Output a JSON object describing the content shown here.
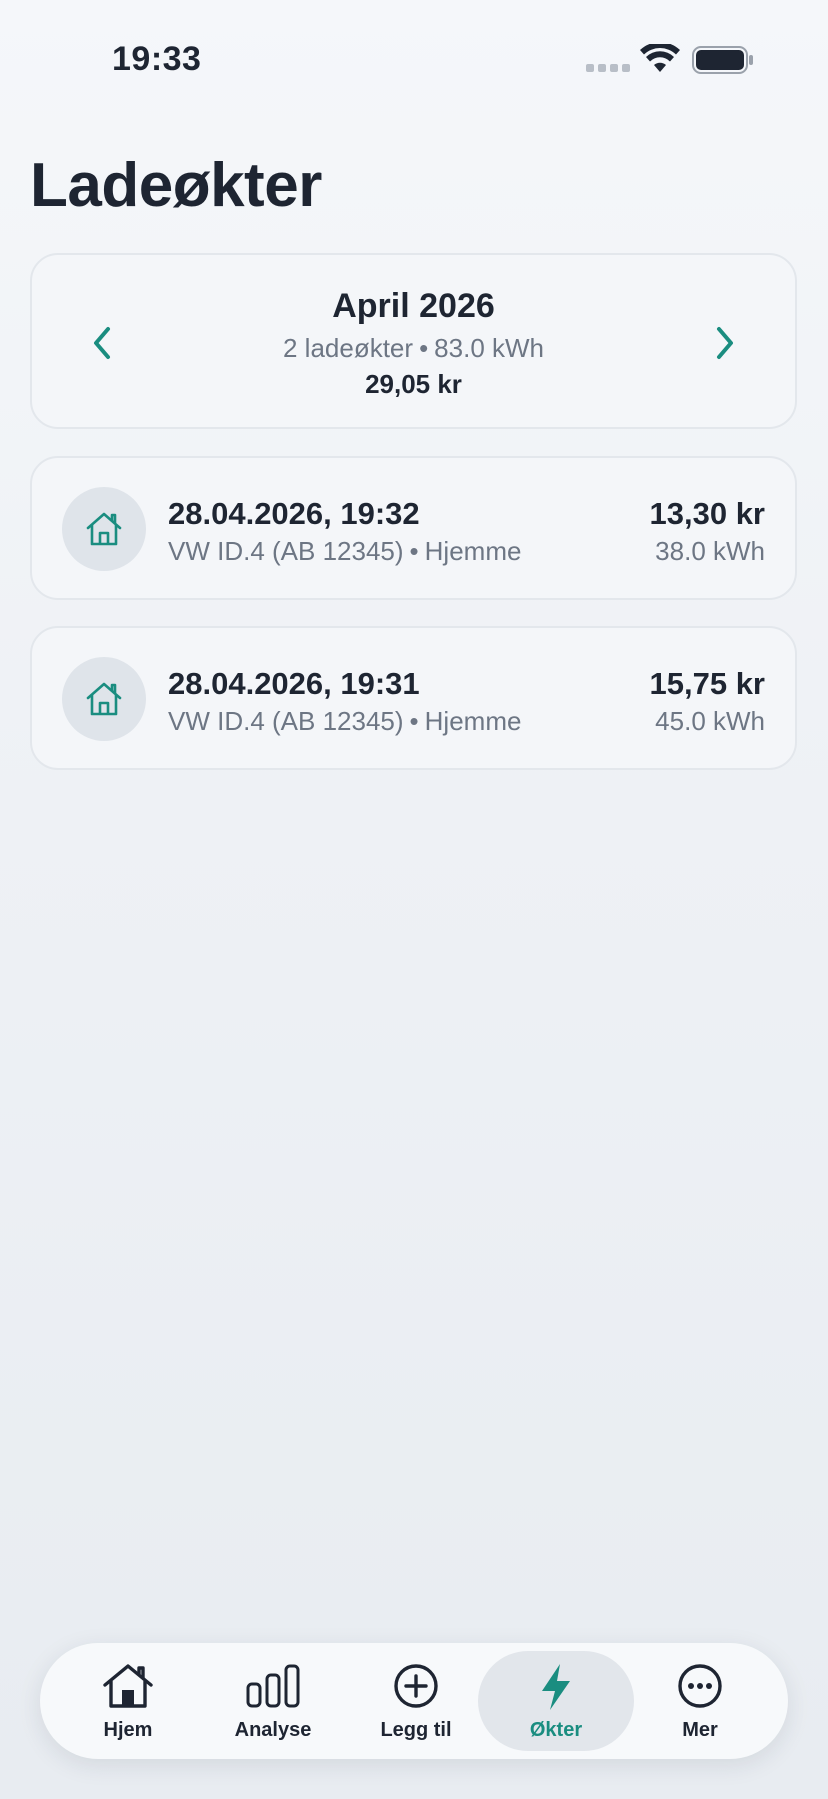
{
  "status_bar": {
    "time": "19:33"
  },
  "page": {
    "title": "Ladeøkter"
  },
  "month_card": {
    "title": "April 2026",
    "sessions_count": "2 ladeøkter",
    "separator": "•",
    "energy": "83.0 kWh",
    "total": "29,05 kr",
    "prev_icon": "chevron-left-icon",
    "next_icon": "chevron-right-icon"
  },
  "sessions": [
    {
      "date": "28.04.2026, 19:32",
      "vehicle": "VW ID.4 (AB 12345)",
      "separator": "•",
      "location": "Hjemme",
      "price": "13,30 kr",
      "energy": "38.0 kWh",
      "icon": "home-icon"
    },
    {
      "date": "28.04.2026, 19:31",
      "vehicle": "VW ID.4 (AB 12345)",
      "separator": "•",
      "location": "Hjemme",
      "price": "15,75 kr",
      "energy": "45.0 kWh",
      "icon": "home-icon"
    }
  ],
  "tab_bar": {
    "items": [
      {
        "label": "Hjem",
        "icon": "home-icon",
        "active": false
      },
      {
        "label": "Analyse",
        "icon": "bar-chart-icon",
        "active": false
      },
      {
        "label": "Legg til",
        "icon": "plus-circle-icon",
        "active": false
      },
      {
        "label": "Økter",
        "icon": "lightning-icon",
        "active": true
      },
      {
        "label": "Mer",
        "icon": "more-icon",
        "active": false
      }
    ]
  },
  "colors": {
    "accent": "#1a8d80",
    "text_primary": "#1e2532",
    "text_secondary": "#6d7684",
    "card_bg": "#f4f6f9",
    "icon_circle_bg": "#dfe4ea"
  }
}
